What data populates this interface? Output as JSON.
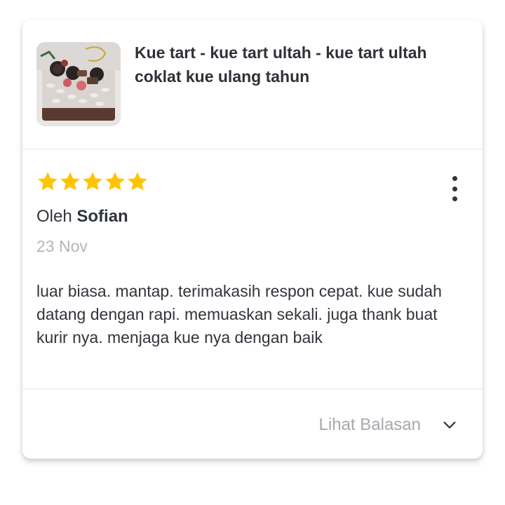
{
  "product": {
    "name": "Kue tart - kue tart ultah - kue tart ultah coklat kue ulang tahun",
    "image_icon": "cake-photo"
  },
  "review": {
    "rating": 5,
    "max_rating": 5,
    "author_prefix": "Oleh",
    "author_name": "Sofian",
    "date": "23 Nov",
    "text": "luar biasa. mantap. terimakasih respon cepat. kue sudah datang dengan rapi. memuaskan sekali. juga thank buat kurir nya. menjaga kue nya dengan baik",
    "menu_icon": "more-vertical-icon",
    "star_color": "#ffc400"
  },
  "footer": {
    "replies_label": "Lihat Balasan",
    "replies_icon": "chevron-down-icon"
  }
}
